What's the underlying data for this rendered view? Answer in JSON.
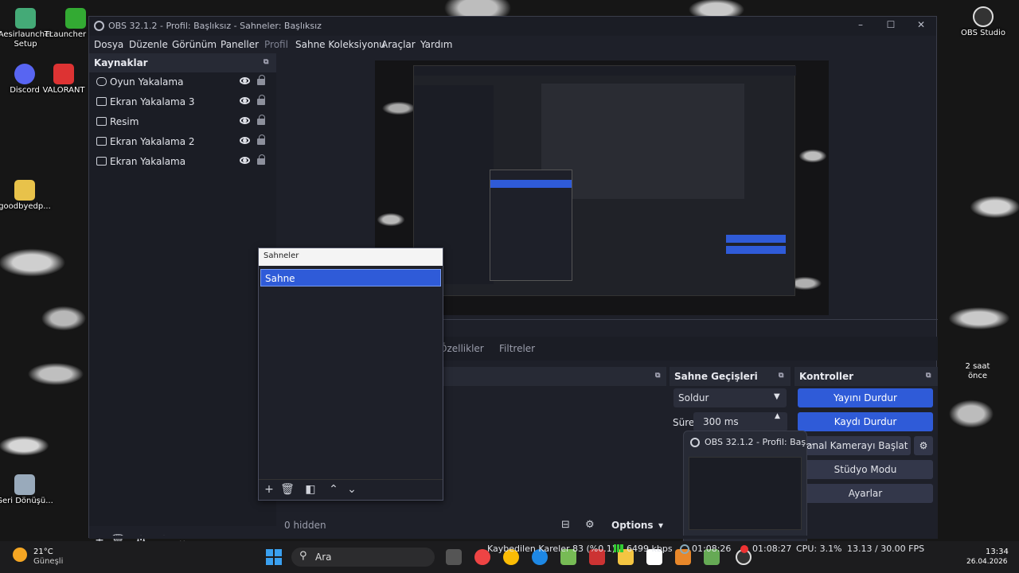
{
  "desktop": {
    "icons": [
      {
        "label": "Aesirlauncher Setup",
        "color": "#4a7"
      },
      {
        "label": "TLauncher Beta",
        "color": "#3a3"
      },
      {
        "label": "Discord",
        "color": "#5865f2"
      },
      {
        "label": "VALORANT",
        "color": "#d33"
      },
      {
        "label": "goodbyedp...",
        "color": "#e8c24a"
      },
      {
        "label": "Geri Dönüşü...",
        "color": "#9ab"
      }
    ],
    "right_icons": [
      {
        "label": "OBS Studio",
        "color": "#333"
      }
    ],
    "weather": {
      "temp": "21°C",
      "label": "Güneşli"
    }
  },
  "window": {
    "title": "OBS 32.1.2 - Profil: Başlıksız - Sahneler: Başlıksız",
    "menu": [
      "Dosya",
      "Düzenle",
      "Görünüm",
      "Paneller",
      "Profil",
      "Sahne Koleksiyonu",
      "Araçlar",
      "Yardım"
    ]
  },
  "sources": {
    "title": "Kaynaklar",
    "items": [
      {
        "name": "Oyun Yakalama",
        "icon": "gamepad-icon"
      },
      {
        "name": "Ekran Yakalama 3",
        "icon": "monitor-icon"
      },
      {
        "name": "Resim",
        "icon": "image-icon"
      },
      {
        "name": "Ekran Yakalama 2",
        "icon": "monitor-icon"
      },
      {
        "name": "Ekran Yakalama",
        "icon": "monitor-icon"
      }
    ]
  },
  "props_bar": {
    "properties": "Özellikler",
    "filters": "Filtreler"
  },
  "audio": {
    "hidden": "0 hidden",
    "options": "Options"
  },
  "transitions": {
    "title": "Sahne Geçişleri",
    "selected": "Soldur",
    "duration_label": "Süre",
    "duration": "300 ms"
  },
  "controls": {
    "title": "Kontroller",
    "stop_stream": "Yayını Durdur",
    "stop_record": "Kaydı Durdur",
    "virtual_cam": "Sanal Kamerayı Başlat",
    "studio_mode": "Stüdyo Modu",
    "settings": "Ayarlar"
  },
  "thumbnail": {
    "title": "OBS 32.1.2 - Profil: Baş..."
  },
  "scenes_popup": {
    "title": "Sahneler",
    "items": [
      "Sahne"
    ]
  },
  "statusbar": {
    "dropped": "Kaybedilen Kareler 83 (%0.1)",
    "bitrate": "6499 kbps",
    "stream_time": "01:08:26",
    "rec_time": "01:08:27",
    "cpu": "CPU: 3.1%",
    "fps": "13.13 / 30.00 FPS"
  },
  "taskbar": {
    "search": "Ara",
    "time": "13:34",
    "date": "26.04.2026"
  },
  "side_texts": [
    "2 saat önce"
  ]
}
